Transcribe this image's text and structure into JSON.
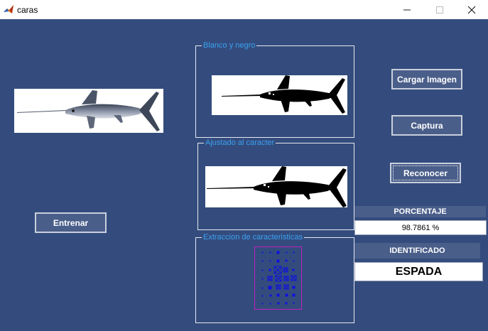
{
  "window": {
    "title": "caras"
  },
  "buttons": {
    "entrenar": "Entrenar",
    "cargar": "Cargar Imagen",
    "captura": "Captura",
    "reconocer": "Reconocer"
  },
  "panels": {
    "bn": "Blanco y negro",
    "ajustado": "Ajustado al caracter",
    "extraccion": "Extraccion de caracteristicas"
  },
  "results": {
    "porcentaje_label": "PORCENTAJE",
    "porcentaje_value": "98.7861 %",
    "identificado_label": "IDENTIFICADO",
    "identificado_value": "ESPADA"
  },
  "colors": {
    "background": "#344c7d",
    "panel_title": "#3aa0f0",
    "feature_marks": "#1010e0",
    "feature_frame": "#c020c0"
  }
}
